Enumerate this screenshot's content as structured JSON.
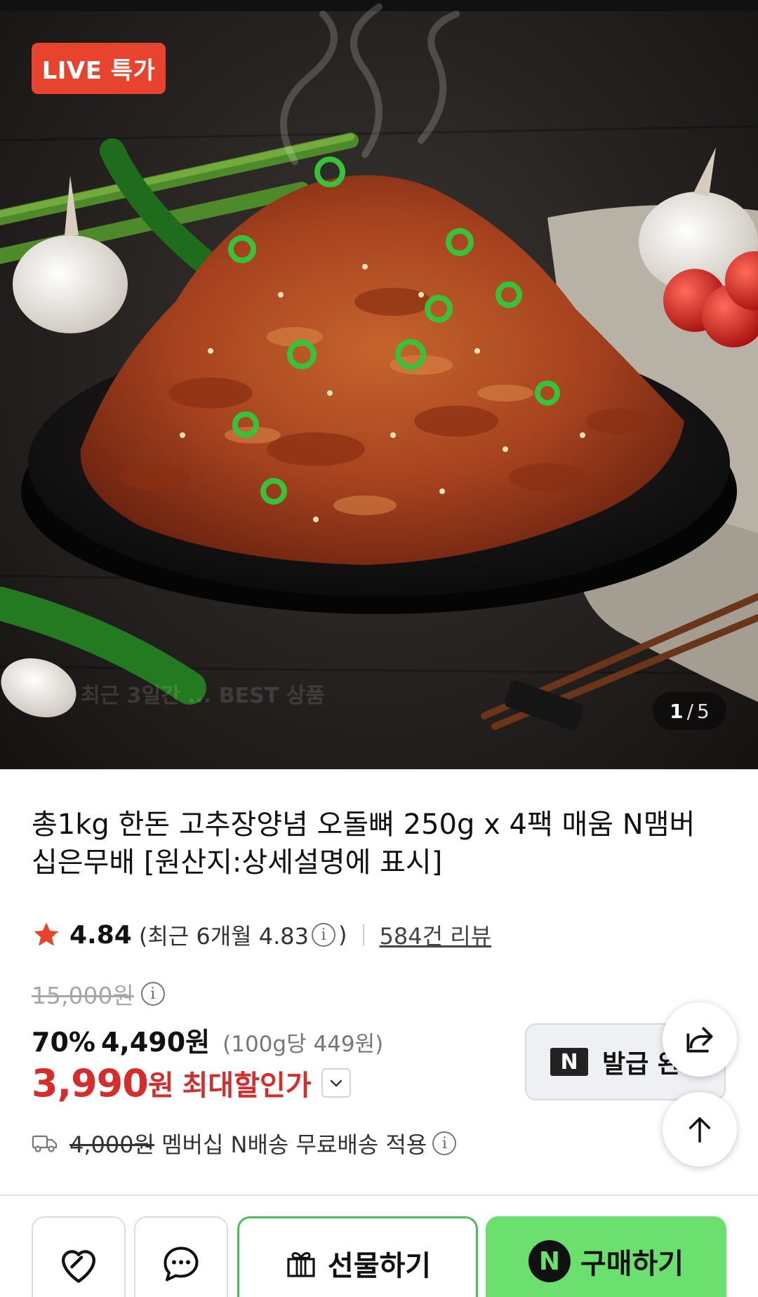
{
  "hero": {
    "badge": "LIVE 특가",
    "counter_current": "1",
    "counter_separator": "/",
    "counter_total": "5",
    "watermark": "최근 3일간 ... BEST 상품"
  },
  "product": {
    "title": "총1kg 한돈 고추장양념 오돌뼈 250g x 4팩 매움 N맴버십은무배 [원산지:상세설명에 표시]",
    "rating": "4.84",
    "recent_prefix": "(최근 6개월 4.83",
    "recent_suffix": ")",
    "reviews": "584건 리뷰",
    "original_price": "15,000원",
    "discount_percent": "70%",
    "sale_price": "4,490원",
    "unit_price": "(100g당 449원)",
    "max_price_number": "3,990",
    "max_price_unit": "원",
    "max_price_label": "최대할인가"
  },
  "coupon": {
    "logo": "N",
    "label": "발급 완료"
  },
  "shipping": {
    "original_fee": "4,000원",
    "text": "멤버십 N배송 무료배송 적용"
  },
  "actions": {
    "gift_label": "선물하기",
    "buy_label": "구매하기",
    "buy_logo": "N"
  },
  "colors": {
    "badge": "#e8432e",
    "price_red": "#d62c2c",
    "buy_green": "#6be06e",
    "gift_border": "#49c05a",
    "star": "#e8432e"
  },
  "icons": [
    "star-icon",
    "info-icon",
    "chevron-down-icon",
    "share-icon",
    "arrow-up-icon",
    "truck-icon",
    "heart-icon",
    "chat-icon",
    "gift-icon"
  ]
}
